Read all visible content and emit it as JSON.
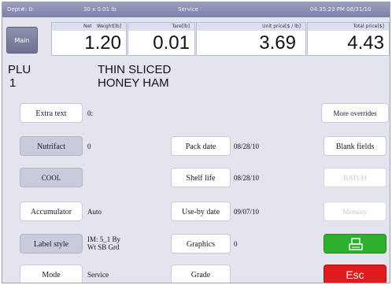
{
  "status_bar": {
    "dept": "Dept#: 0:",
    "scale": "30 x 0.01 lb",
    "mode": "Service",
    "datetime": "04:35:23 PM   08/31/10"
  },
  "main_label": "Main",
  "weights": {
    "net_label": "Net",
    "weight_label": "Weight[lb]",
    "weight": "1.20",
    "tare_label": "Tare[lb]",
    "tare": "0.01",
    "unit_price_label": "Unit price[$ / lb]",
    "unit_price": "3.69",
    "total_price_label": "Total price[$]",
    "total_price": "4.43"
  },
  "plu": {
    "label": "PLU",
    "number": "1",
    "name_line1": "THIN SLICED",
    "name_line2": "HONEY HAM"
  },
  "left_buttons": {
    "extra_text": "Extra text",
    "nutrifact": "Nutrifact",
    "cool": "COOL",
    "accumulator": "Accumulator",
    "label_style": "Label style",
    "mode": "Mode"
  },
  "left_values": {
    "extra_text": "0:",
    "nutrifact": "0",
    "accumulator": "Auto",
    "label_style_1": "IM: 5_1 By",
    "label_style_2": "Wt SB Grd",
    "mode": "Service"
  },
  "mid_buttons": {
    "pack_date": "Pack date",
    "shelf_life": "Shelf life",
    "use_by_date": "Use-by date",
    "graphics": "Graphics",
    "grade": "Grade"
  },
  "mid_values": {
    "pack_date": "08/28/10",
    "shelf_life": "08/28/10",
    "use_by_date": "09/07/10",
    "graphics": "0"
  },
  "right_buttons": {
    "more_overrides": "More overrides",
    "blank_fields": "Blank fields",
    "batch": "BATCH",
    "memory": "Memory",
    "esc": "Esc"
  },
  "icons": {
    "print": "printer-icon"
  },
  "colors": {
    "print": "#2eb02e",
    "esc": "#e01b1b"
  }
}
